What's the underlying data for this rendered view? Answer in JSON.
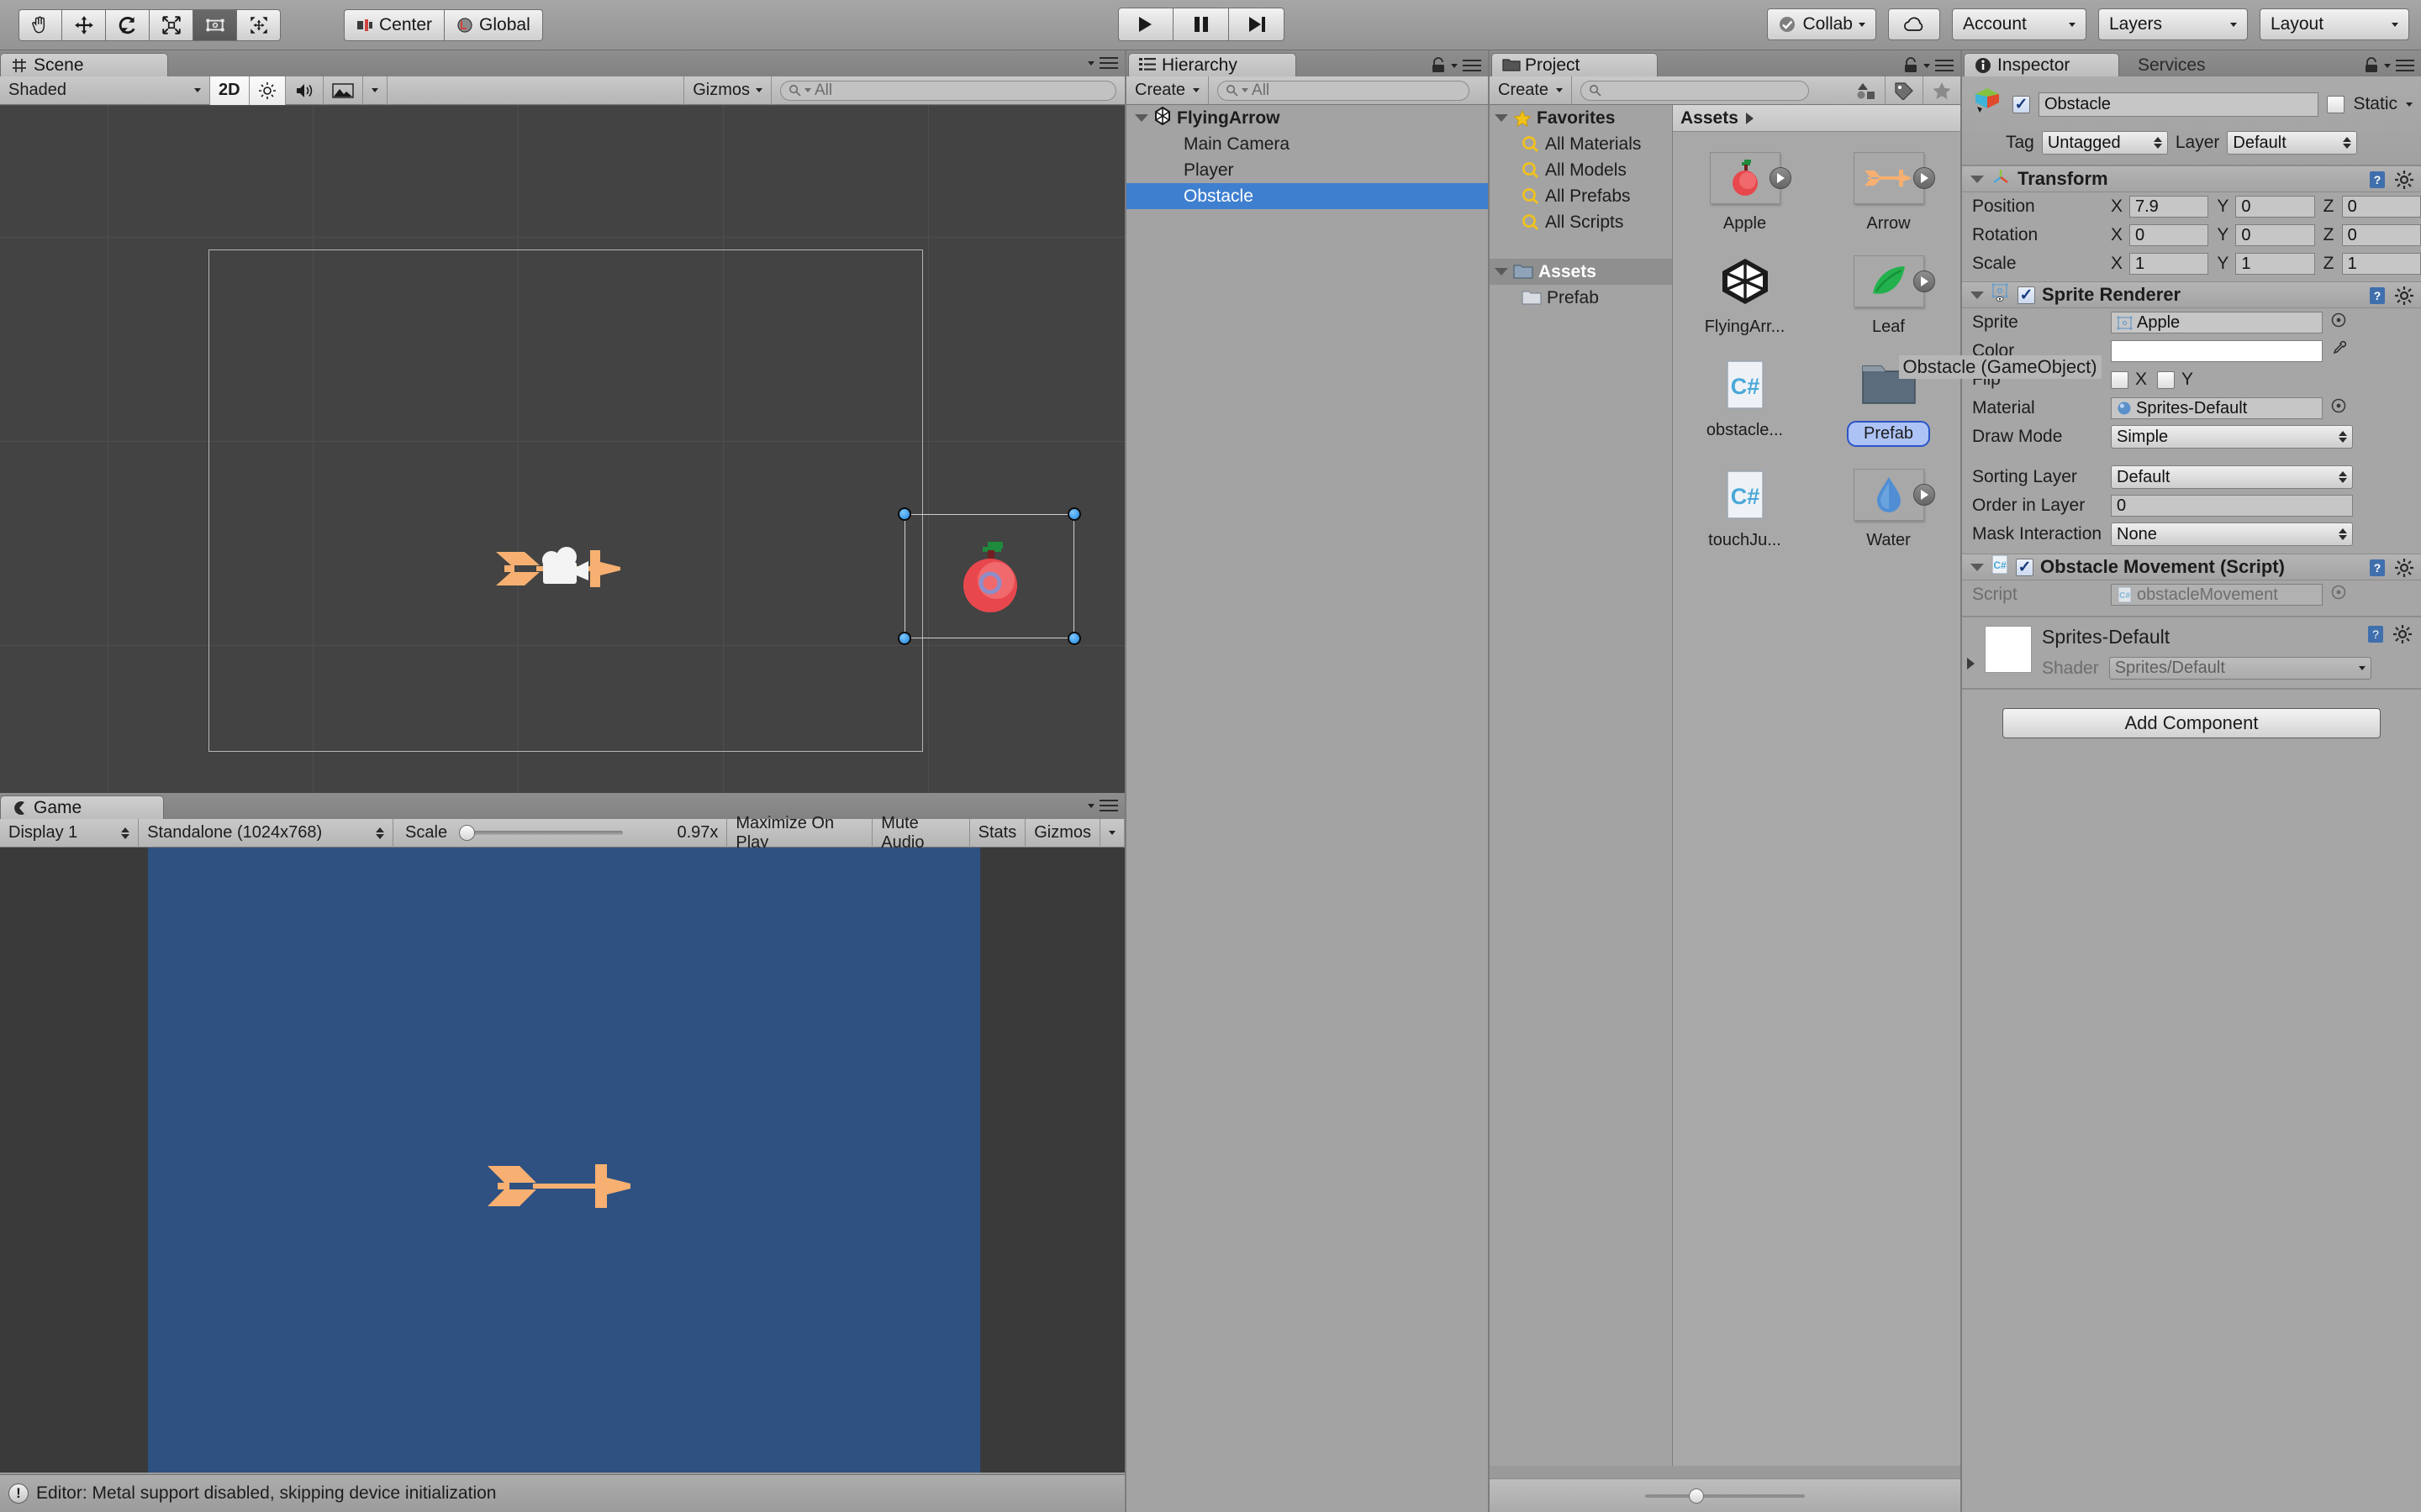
{
  "toolbar": {
    "transform_tools": [
      {
        "name": "hand-tool",
        "active": false
      },
      {
        "name": "move-tool",
        "active": false
      },
      {
        "name": "rotate-tool",
        "active": false
      },
      {
        "name": "scale-tool",
        "active": false
      },
      {
        "name": "rect-tool",
        "active": true
      },
      {
        "name": "transform-tool",
        "active": false
      }
    ],
    "pivot_label": "Center",
    "handle_label": "Global",
    "play_label": "play-icon",
    "pause_label": "pause-icon",
    "step_label": "step-icon",
    "collab_label": "Collab",
    "cloud_label": "cloud-icon",
    "account_label": "Account",
    "layers_label": "Layers",
    "layout_label": "Layout"
  },
  "scene": {
    "tab_label": "Scene",
    "shading_mode": "Shaded",
    "mode_2d": "2D",
    "lighting_icon": "sun-icon",
    "audio_icon": "speaker-icon",
    "fx_icon": "image-icon",
    "gizmos_label": "Gizmos",
    "search_placeholder": "All"
  },
  "game": {
    "tab_label": "Game",
    "display": "Display 1",
    "resolution": "Standalone (1024x768)",
    "scale_label": "Scale",
    "scale_value": "0.97x",
    "maximize_label": "Maximize On Play",
    "mute_label": "Mute Audio",
    "stats_label": "Stats",
    "gizmos_label": "Gizmos"
  },
  "hierarchy": {
    "tab_label": "Hierarchy",
    "create_label": "Create",
    "search_placeholder": "All",
    "items": [
      {
        "label": "FlyingArrow",
        "depth": 0,
        "root": true,
        "selected": false
      },
      {
        "label": "Main Camera",
        "depth": 1,
        "root": false,
        "selected": false
      },
      {
        "label": "Player",
        "depth": 1,
        "root": false,
        "selected": false
      },
      {
        "label": "Obstacle",
        "depth": 1,
        "root": false,
        "selected": true
      }
    ]
  },
  "project": {
    "tab_label": "Project",
    "create_label": "Create",
    "search_placeholder": "",
    "tree": [
      {
        "label": "Favorites",
        "icon": "star-icon",
        "depth": 0,
        "head": true,
        "selected": false
      },
      {
        "label": "All Materials",
        "icon": "search-icon",
        "depth": 1,
        "head": false,
        "selected": false
      },
      {
        "label": "All Models",
        "icon": "search-icon",
        "depth": 1,
        "head": false,
        "selected": false
      },
      {
        "label": "All Prefabs",
        "icon": "search-icon",
        "depth": 1,
        "head": false,
        "selected": false
      },
      {
        "label": "All Scripts",
        "icon": "search-icon",
        "depth": 1,
        "head": false,
        "selected": false
      },
      {
        "label": "Assets",
        "icon": "folder-icon",
        "depth": 0,
        "head": true,
        "selected": true
      },
      {
        "label": "Prefab",
        "icon": "folder-icon",
        "depth": 1,
        "head": false,
        "selected": false
      }
    ],
    "breadcrumb": "Assets",
    "items": [
      {
        "label": "Apple",
        "type": "sprite",
        "sprite": "apple",
        "selected": false
      },
      {
        "label": "Arrow",
        "type": "sprite",
        "sprite": "arrow",
        "selected": false
      },
      {
        "label": "FlyingArr...",
        "type": "scene",
        "sprite": "unity",
        "selected": false
      },
      {
        "label": "Leaf",
        "type": "sprite",
        "sprite": "leaf",
        "selected": false
      },
      {
        "label": "obstacle...",
        "type": "script",
        "sprite": "csharp",
        "selected": false
      },
      {
        "label": "Prefab",
        "type": "folder",
        "sprite": "folder",
        "selected": true
      },
      {
        "label": "touchJu...",
        "type": "script",
        "sprite": "csharp",
        "selected": false
      },
      {
        "label": "Water",
        "type": "sprite",
        "sprite": "water",
        "selected": false
      }
    ],
    "tooltip": "Obstacle (GameObject)"
  },
  "inspector": {
    "tab_label": "Inspector",
    "services_tab_label": "Services",
    "object_name": "Obstacle",
    "object_enabled": true,
    "static_label": "Static",
    "static_checked": false,
    "tag_label": "Tag",
    "tag_value": "Untagged",
    "layer_label": "Layer",
    "layer_value": "Default",
    "transform": {
      "title": "Transform",
      "rows": [
        {
          "label": "Position",
          "x": "7.9",
          "y": "0",
          "z": "0"
        },
        {
          "label": "Rotation",
          "x": "0",
          "y": "0",
          "z": "0"
        },
        {
          "label": "Scale",
          "x": "1",
          "y": "1",
          "z": "1"
        }
      ]
    },
    "sprite_renderer": {
      "title": "Sprite Renderer",
      "enabled": true,
      "sprite_label": "Sprite",
      "sprite_value": "Apple",
      "color_label": "Color",
      "color_value": "#ffffff",
      "flip_label": "Flip",
      "flip_x_label": "X",
      "flip_y_label": "Y",
      "flip_x": false,
      "flip_y": false,
      "material_label": "Material",
      "material_value": "Sprites-Default",
      "draw_mode_label": "Draw Mode",
      "draw_mode_value": "Simple",
      "sorting_layer_label": "Sorting Layer",
      "sorting_layer_value": "Default",
      "order_label": "Order in Layer",
      "order_value": "0",
      "mask_label": "Mask Interaction",
      "mask_value": "None"
    },
    "script_component": {
      "title": "Obstacle Movement (Script)",
      "enabled": true,
      "script_label": "Script",
      "script_value": "obstacleMovement"
    },
    "material": {
      "title": "Sprites-Default",
      "shader_label": "Shader",
      "shader_value": "Sprites/Default"
    },
    "add_component_label": "Add Component"
  },
  "statusbar": {
    "message": "Editor: Metal support disabled, skipping device initialization",
    "icon": "warning-icon"
  },
  "colors": {
    "selection_blue": "#3f7fd0",
    "handle_blue": "#1f86e0",
    "game_bg": "#2f5182",
    "arrow_orange": "#f7b071",
    "apple_red": "#e8484d",
    "leaf_green": "#22b14c",
    "water_blue": "#4f8ed4"
  }
}
